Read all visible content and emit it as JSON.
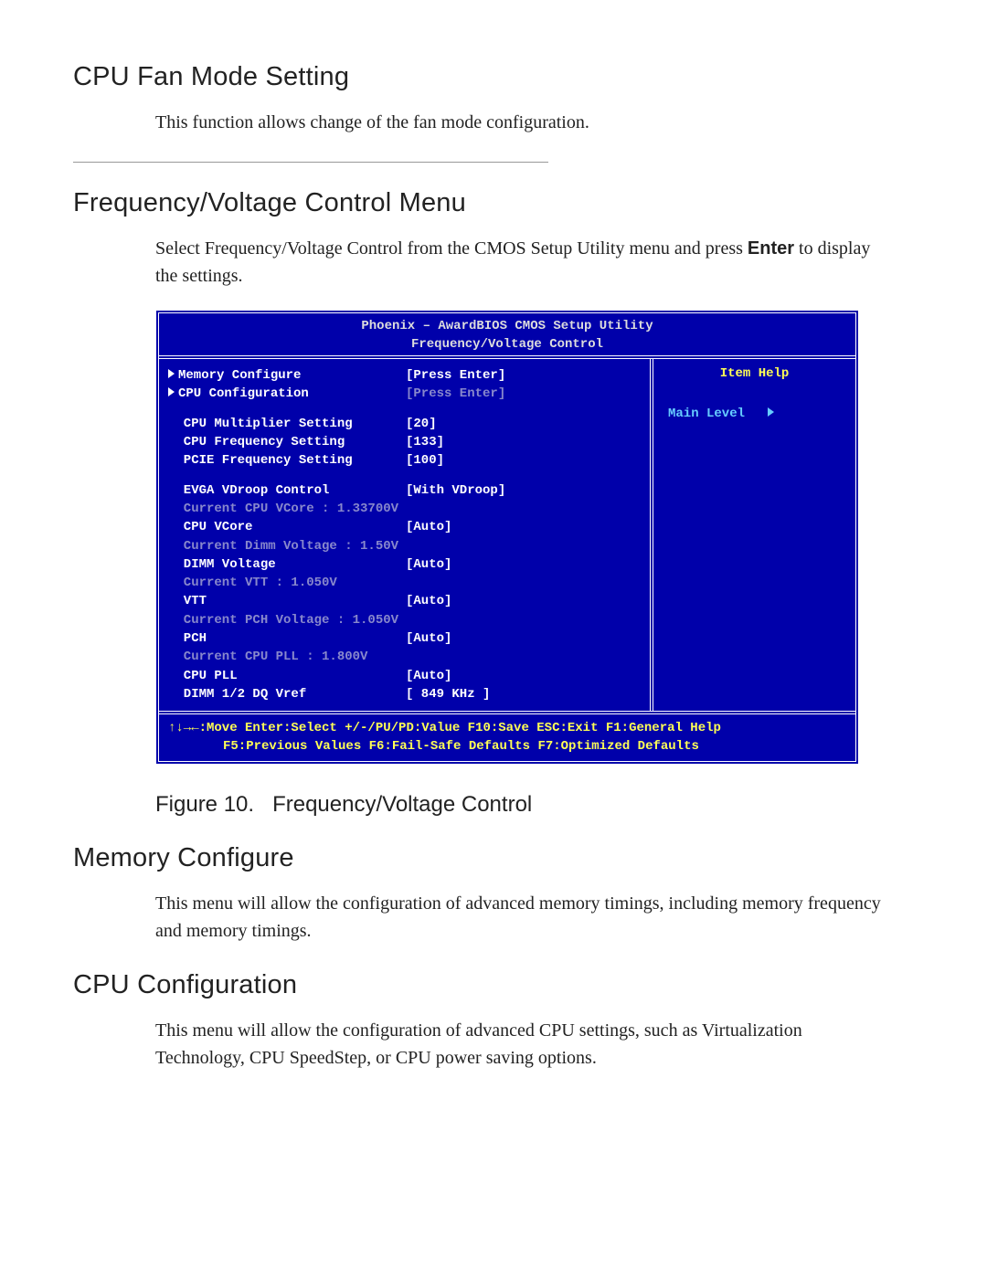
{
  "headings": {
    "cpu_fan": "CPU Fan Mode Setting",
    "freq_menu": "Frequency/Voltage Control Menu",
    "mem_conf": "Memory Configure",
    "cpu_conf": "CPU Configuration"
  },
  "paragraphs": {
    "cpu_fan": "This function allows change of the fan mode configuration.",
    "freq_menu_1": "Select Frequency/Voltage Control from the CMOS Setup Utility menu and press ",
    "freq_menu_enter": "Enter",
    "freq_menu_2": " to display the settings.",
    "mem_conf": "This menu will allow the configuration of advanced memory timings, including memory frequency and memory timings.",
    "cpu_conf": "This menu will allow the configuration of advanced CPU settings, such as Virtualization Technology, CPU SpeedStep, or CPU power saving options."
  },
  "bios": {
    "title1": "Phoenix – AwardBIOS CMOS Setup Utility",
    "title2": "Frequency/Voltage Control",
    "help_title": "Item Help",
    "main_level": "Main Level",
    "rows": [
      {
        "label": "Memory Configure",
        "value": "[Press Enter]",
        "arrow": true,
        "white": true
      },
      {
        "label": "CPU Configuration",
        "value": "[Press Enter]",
        "arrow": true,
        "white": true,
        "dimval": true
      },
      {
        "spacer": true
      },
      {
        "label": "  CPU Multiplier Setting",
        "value": "[20]",
        "white": true
      },
      {
        "label": "  CPU Frequency Setting",
        "value": "[133]",
        "white": true
      },
      {
        "label": "  PCIE Frequency Setting",
        "value": "[100]",
        "white": true
      },
      {
        "spacer": true
      },
      {
        "label": "  EVGA VDroop Control",
        "value": "[With VDroop]",
        "white": true
      },
      {
        "label": "  Current CPU VCore : 1.33700V",
        "value": "",
        "dim": true
      },
      {
        "label": "  CPU VCore",
        "value": "[Auto]",
        "white": true
      },
      {
        "label": "  Current Dimm Voltage : 1.50V",
        "value": "",
        "dim": true
      },
      {
        "label": "  DIMM Voltage",
        "value": "[Auto]",
        "white": true
      },
      {
        "label": "  Current VTT : 1.050V",
        "value": "",
        "dim": true
      },
      {
        "label": "  VTT",
        "value": "[Auto]",
        "white": true
      },
      {
        "label": "  Current PCH Voltage : 1.050V",
        "value": "",
        "dim": true
      },
      {
        "label": "  PCH",
        "value": "[Auto]",
        "white": true
      },
      {
        "label": "  Current CPU PLL : 1.800V",
        "value": "",
        "dim": true
      },
      {
        "label": "  CPU PLL",
        "value": "[Auto]",
        "white": true
      },
      {
        "label": "  DIMM 1/2 DQ Vref",
        "value": "[ 849 KHz ]",
        "white": true
      }
    ],
    "footer1": "↑↓→←:Move  Enter:Select  +/-/PU/PD:Value  F10:Save  ESC:Exit  F1:General Help",
    "footer2": "F5:Previous Values   F6:Fail-Safe Defaults  F7:Optimized Defaults"
  },
  "figure": {
    "num": "Figure 10.",
    "caption": "Frequency/Voltage Control"
  }
}
